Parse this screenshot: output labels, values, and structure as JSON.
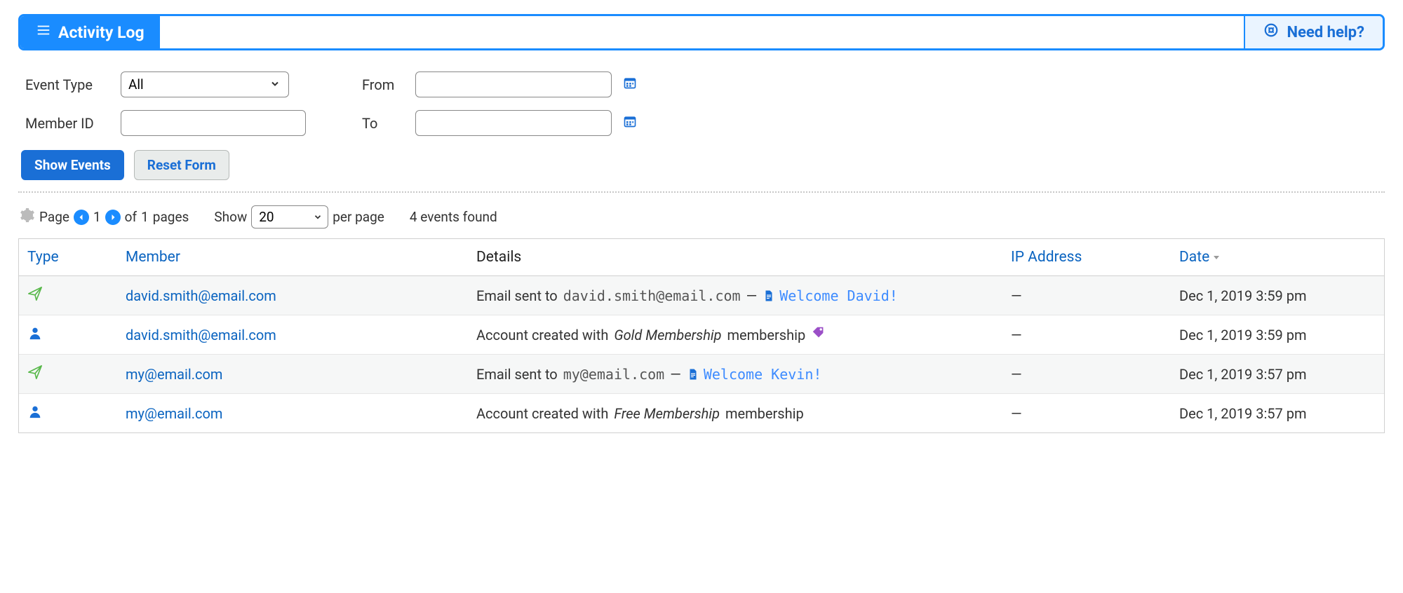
{
  "header": {
    "title": "Activity Log",
    "help_label": "Need help?"
  },
  "filters": {
    "event_type_label": "Event Type",
    "event_type_value": "All",
    "member_id_label": "Member ID",
    "member_id_value": "",
    "from_label": "From",
    "from_value": "",
    "to_label": "To",
    "to_value": ""
  },
  "buttons": {
    "show_events": "Show Events",
    "reset_form": "Reset Form"
  },
  "pager": {
    "page_word": "Page",
    "page_current": "1",
    "pages_of_prefix": "of",
    "pages_total": "1",
    "pages_word": "pages",
    "show_word": "Show",
    "per_page_value": "20",
    "per_page_word": "per page",
    "found_text": "4 events found"
  },
  "table": {
    "headers": {
      "type": "Type",
      "member": "Member",
      "details": "Details",
      "ip": "IP Address",
      "date": "Date"
    },
    "rows": [
      {
        "icon": "send",
        "member": "david.smith@email.com",
        "detail_kind": "email",
        "email_prefix": "Email sent to",
        "email_addr": "david.smith@email.com",
        "email_subject": "Welcome David!",
        "ip": "—",
        "date": "Dec 1, 2019 3:59 pm"
      },
      {
        "icon": "user",
        "member": "david.smith@email.com",
        "detail_kind": "account",
        "account_prefix": "Account created with",
        "membership_name": "Gold Membership",
        "membership_word": "membership",
        "show_tag": true,
        "ip": "—",
        "date": "Dec 1, 2019 3:59 pm"
      },
      {
        "icon": "send",
        "member": "my@email.com",
        "detail_kind": "email",
        "email_prefix": "Email sent to",
        "email_addr": "my@email.com",
        "email_subject": "Welcome Kevin!",
        "ip": "—",
        "date": "Dec 1, 2019 3:57 pm"
      },
      {
        "icon": "user",
        "member": "my@email.com",
        "detail_kind": "account",
        "account_prefix": "Account created with",
        "membership_name": "Free Membership",
        "membership_word": "membership",
        "show_tag": false,
        "ip": "—",
        "date": "Dec 1, 2019 3:57 pm"
      }
    ]
  }
}
